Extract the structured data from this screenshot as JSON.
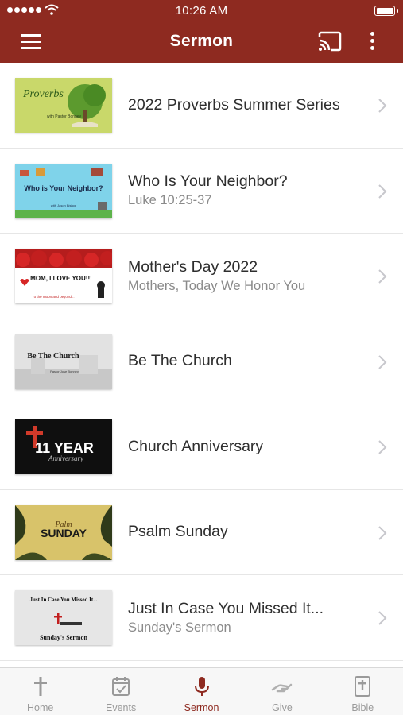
{
  "status_bar": {
    "time": "10:26 AM"
  },
  "header": {
    "title": "Sermon",
    "menu_icon": "hamburger-menu-icon",
    "cast_icon": "cast-icon",
    "more_icon": "more-vertical-icon"
  },
  "colors": {
    "brand": "#8e2a20",
    "tab_inactive": "#9a9a9a",
    "subtitle": "#8a8a8a"
  },
  "sermons": [
    {
      "title": "2022 Proverbs Summer Series",
      "subtitle": "",
      "thumb_text": "Proverbs",
      "thumb_sub": "with Pastor Bonney"
    },
    {
      "title": "Who Is Your Neighbor?",
      "subtitle": "Luke 10:25-37",
      "thumb_text": "Who is Your Neighbor?",
      "thumb_sub": "with Jason Bishop"
    },
    {
      "title": "Mother's Day 2022",
      "subtitle": "Mothers, Today We Honor You",
      "thumb_text": "MOM, I LOVE YOU!!!",
      "thumb_sub": "To the moon and beyond..."
    },
    {
      "title": "Be The Church",
      "subtitle": "",
      "thumb_text": "Be The Church",
      "thumb_sub": "Pastor Jose Bonney"
    },
    {
      "title": "Church Anniversary",
      "subtitle": "",
      "thumb_text": "11 YEAR",
      "thumb_sub": "Anniversary"
    },
    {
      "title": "Psalm Sunday",
      "subtitle": "",
      "thumb_text": "SUNDAY",
      "thumb_sub": "Palm"
    },
    {
      "title": "Just In Case You Missed It...",
      "subtitle": "Sunday's Sermon",
      "thumb_text": "Just In Case You Missed It...",
      "thumb_sub": "Sunday's Sermon"
    }
  ],
  "tabs": [
    {
      "label": "Home",
      "icon": "cross-icon",
      "active": false
    },
    {
      "label": "Events",
      "icon": "calendar-check-icon",
      "active": false
    },
    {
      "label": "Sermon",
      "icon": "microphone-icon",
      "active": true
    },
    {
      "label": "Give",
      "icon": "giving-hand-icon",
      "active": false
    },
    {
      "label": "Bible",
      "icon": "bible-icon",
      "active": false
    }
  ]
}
